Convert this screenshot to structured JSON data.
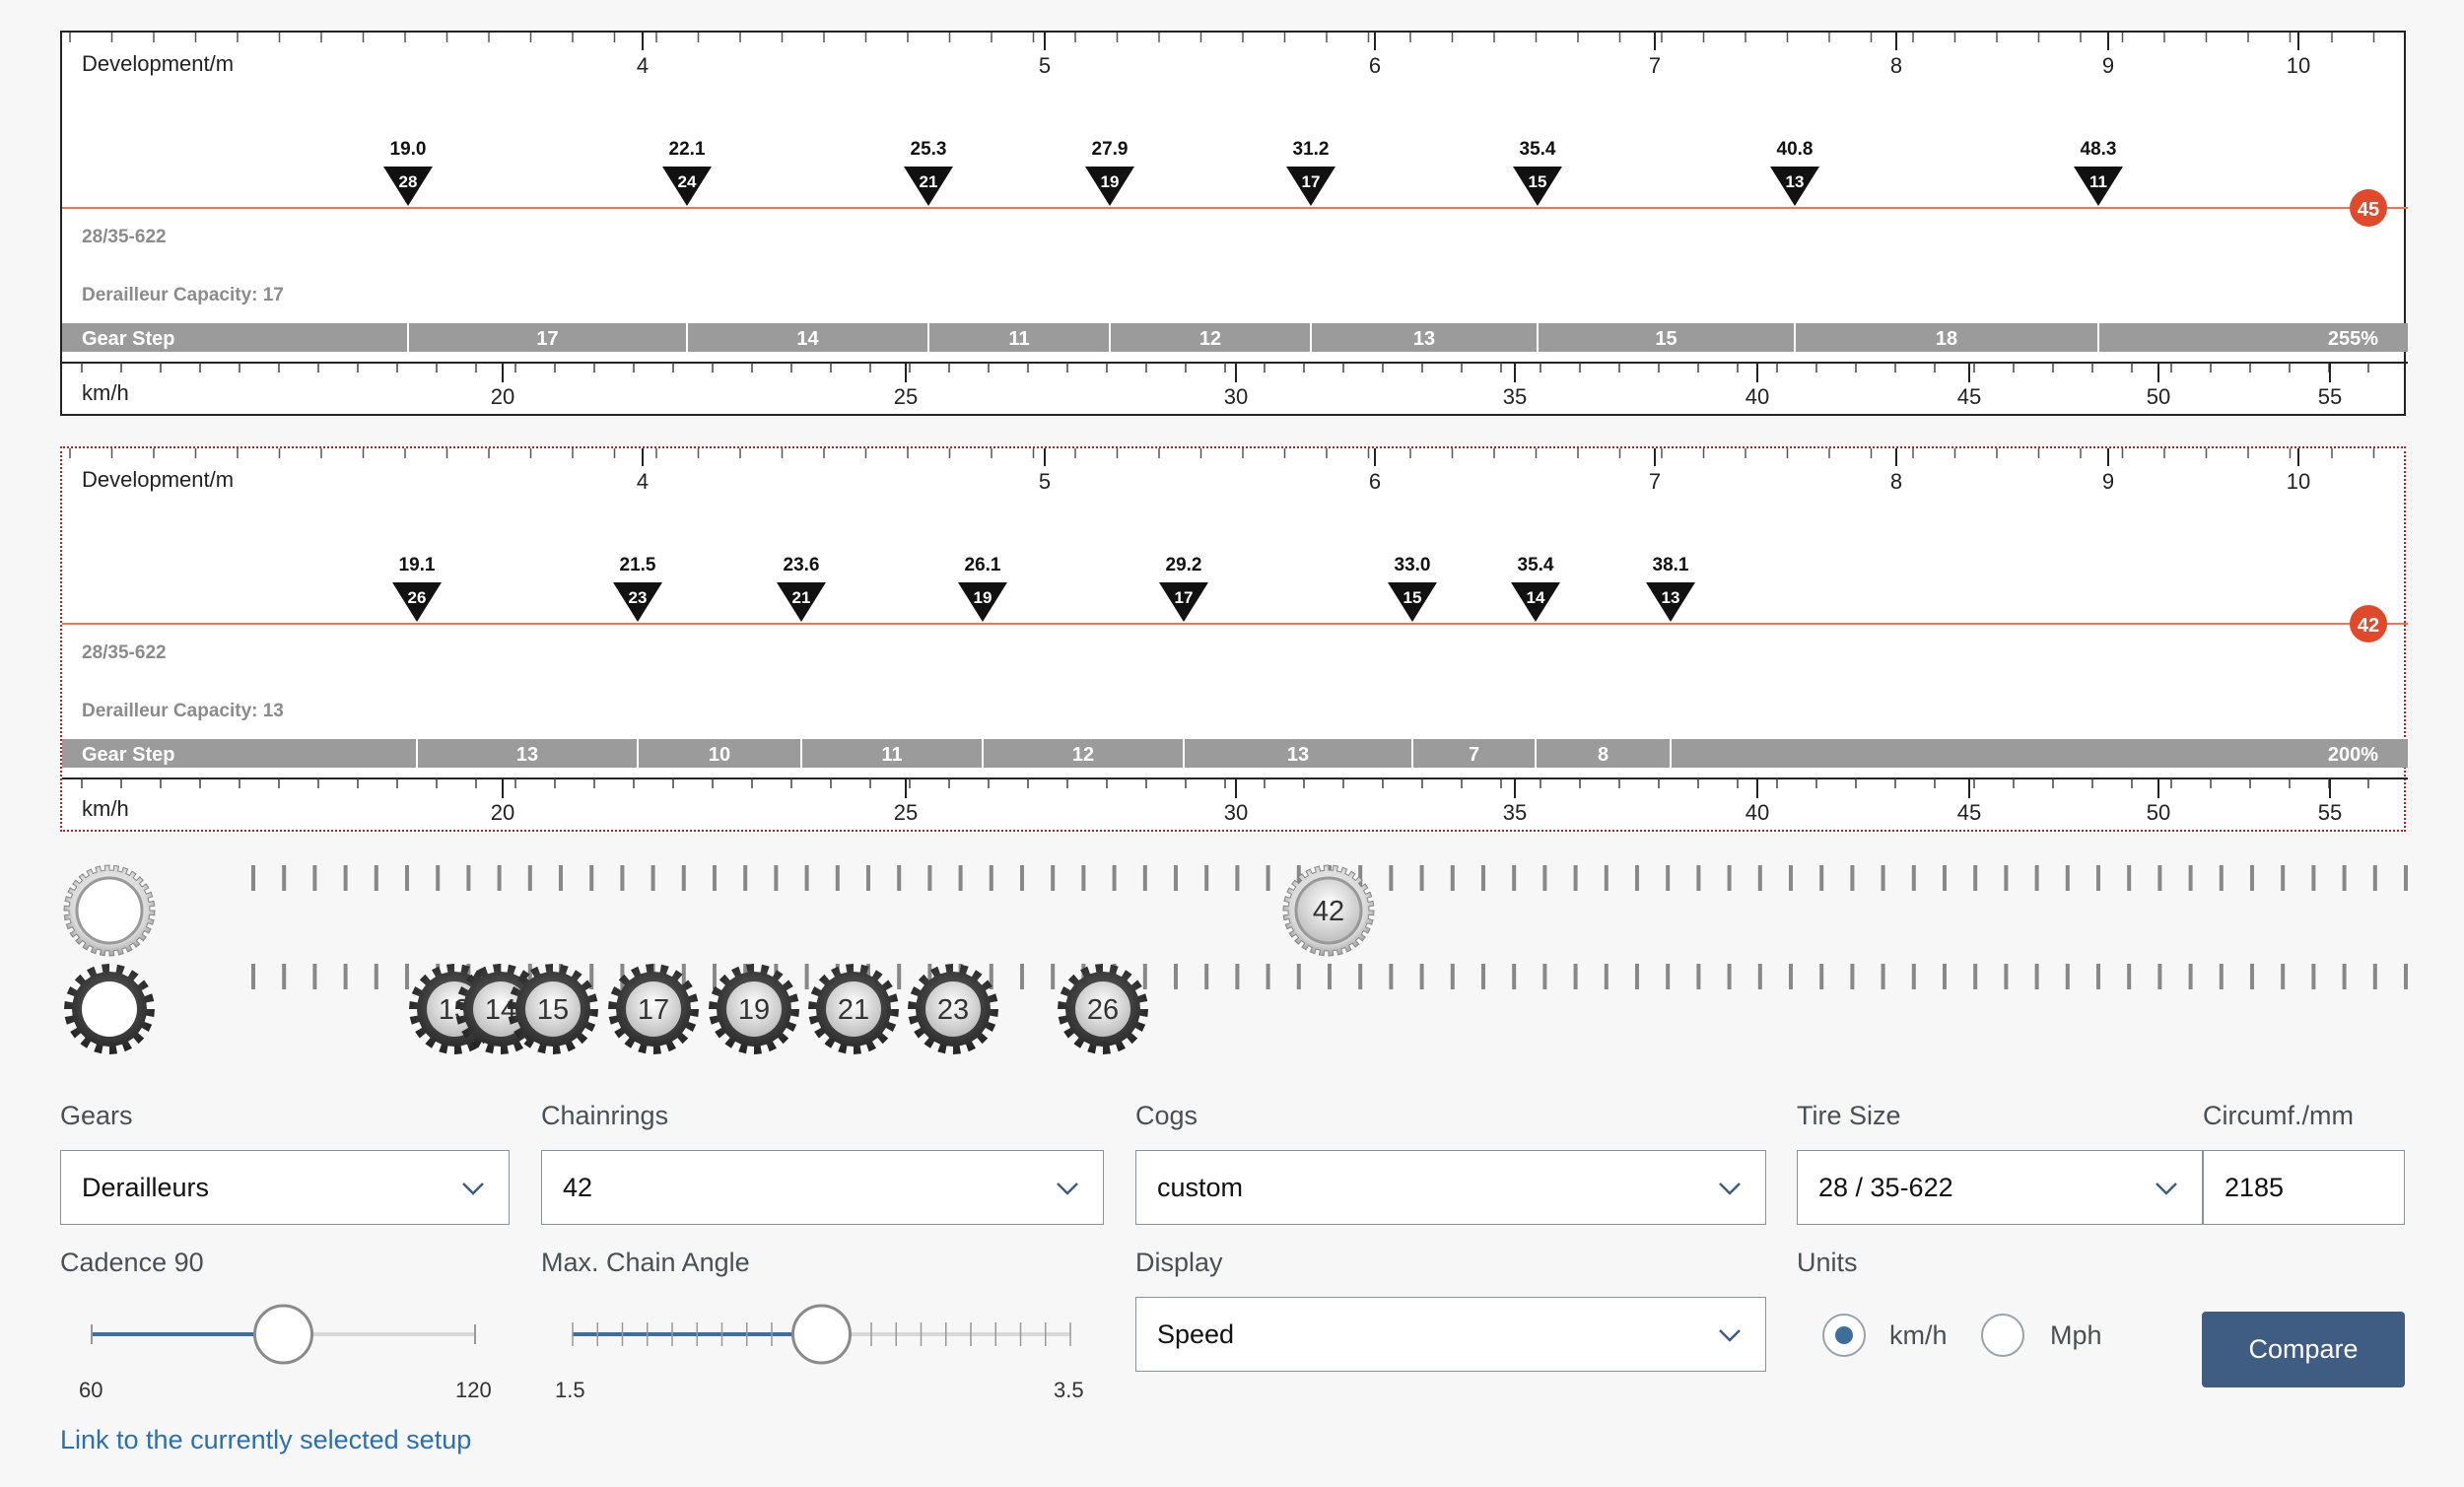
{
  "panels": [
    {
      "dev_label": "Development/m",
      "dev_ticks": [
        "4",
        "5",
        "6",
        "7",
        "8",
        "9",
        "10"
      ],
      "markers": [
        {
          "speed": "19.0",
          "cog": "28"
        },
        {
          "speed": "22.1",
          "cog": "24"
        },
        {
          "speed": "25.3",
          "cog": "21"
        },
        {
          "speed": "27.9",
          "cog": "19"
        },
        {
          "speed": "31.2",
          "cog": "17"
        },
        {
          "speed": "35.4",
          "cog": "15"
        },
        {
          "speed": "40.8",
          "cog": "13"
        },
        {
          "speed": "48.3",
          "cog": "11"
        }
      ],
      "chainring": "45",
      "tire": "28/35-622",
      "capacity": "Derailleur Capacity: 17",
      "gear_step_label": "Gear Step",
      "gear_steps": [
        "17",
        "14",
        "11",
        "12",
        "13",
        "15",
        "18"
      ],
      "range": "255%",
      "speed_label": "km/h",
      "speed_ticks": [
        "20",
        "25",
        "30",
        "35",
        "40",
        "45",
        "50",
        "55"
      ]
    },
    {
      "dev_label": "Development/m",
      "dev_ticks": [
        "4",
        "5",
        "6",
        "7",
        "8",
        "9",
        "10"
      ],
      "markers": [
        {
          "speed": "19.1",
          "cog": "26"
        },
        {
          "speed": "21.5",
          "cog": "23"
        },
        {
          "speed": "23.6",
          "cog": "21"
        },
        {
          "speed": "26.1",
          "cog": "19"
        },
        {
          "speed": "29.2",
          "cog": "17"
        },
        {
          "speed": "33.0",
          "cog": "15"
        },
        {
          "speed": "35.4",
          "cog": "14"
        },
        {
          "speed": "38.1",
          "cog": "13"
        }
      ],
      "chainring": "42",
      "tire": "28/35-622",
      "capacity": "Derailleur Capacity: 13",
      "gear_step_label": "Gear Step",
      "gear_steps": [
        "13",
        "10",
        "11",
        "12",
        "13",
        "7",
        "8"
      ],
      "range": "200%",
      "speed_label": "km/h",
      "speed_ticks": [
        "20",
        "25",
        "30",
        "35",
        "40",
        "45",
        "50",
        "55"
      ]
    }
  ],
  "selector": {
    "chainring_value": "42",
    "cogs": [
      "13",
      "14",
      "15",
      "17",
      "19",
      "21",
      "23",
      "26"
    ]
  },
  "controls": {
    "gears_label": "Gears",
    "gears_value": "Derailleurs",
    "chainrings_label": "Chainrings",
    "chainrings_value": "42",
    "cogs_label": "Cogs",
    "cogs_value": "custom",
    "tire_label": "Tire Size",
    "tire_value": "28 / 35-622",
    "circ_label": "Circumf./mm",
    "circ_value": "2185",
    "cadence_label": "Cadence 90",
    "cadence_min": "60",
    "cadence_max": "120",
    "cadence_value": 90,
    "chain_label": "Max. Chain Angle",
    "chain_min": "1.5",
    "chain_max": "3.5",
    "chain_value": 2.5,
    "display_label": "Display",
    "display_value": "Speed",
    "units_label": "Units",
    "unit_kmh": "km/h",
    "unit_mph": "Mph",
    "unit_selected": "km/h",
    "compare_label": "Compare",
    "link_text": "Link to the currently selected setup"
  },
  "colors": {
    "accent_red": "#e04a2a",
    "button_blue": "#3f5d82",
    "gear_step_bar": "#9b9b9b"
  }
}
